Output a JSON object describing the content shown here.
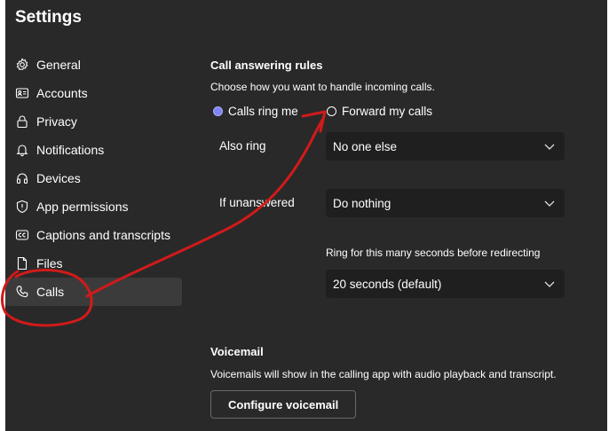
{
  "title": "Settings",
  "nav": [
    {
      "label": "General",
      "icon": "gear-icon"
    },
    {
      "label": "Accounts",
      "icon": "id-card-icon"
    },
    {
      "label": "Privacy",
      "icon": "lock-icon"
    },
    {
      "label": "Notifications",
      "icon": "bell-icon"
    },
    {
      "label": "Devices",
      "icon": "headset-icon"
    },
    {
      "label": "App permissions",
      "icon": "shield-icon"
    },
    {
      "label": "Captions and transcripts",
      "icon": "cc-icon"
    },
    {
      "label": "Files",
      "icon": "file-icon"
    },
    {
      "label": "Calls",
      "icon": "phone-icon",
      "active": true
    }
  ],
  "call_answering": {
    "heading": "Call answering rules",
    "description": "Choose how you want to handle incoming calls.",
    "option_ring": "Calls ring me",
    "option_forward": "Forward my calls",
    "selected": "Calls ring me",
    "also_ring_label": "Also ring",
    "also_ring_value": "No one else",
    "if_unanswered_label": "If unanswered",
    "if_unanswered_value": "Do nothing",
    "ring_seconds_label": "Ring for this many seconds before redirecting",
    "ring_seconds_value": "20 seconds (default)"
  },
  "voicemail": {
    "heading": "Voicemail",
    "description": "Voicemails will show in the calling app with audio playback and transcript.",
    "button": "Configure voicemail"
  },
  "colors": {
    "background": "#292929",
    "accent": "#7f85f5",
    "annotation": "#d11a1a"
  }
}
